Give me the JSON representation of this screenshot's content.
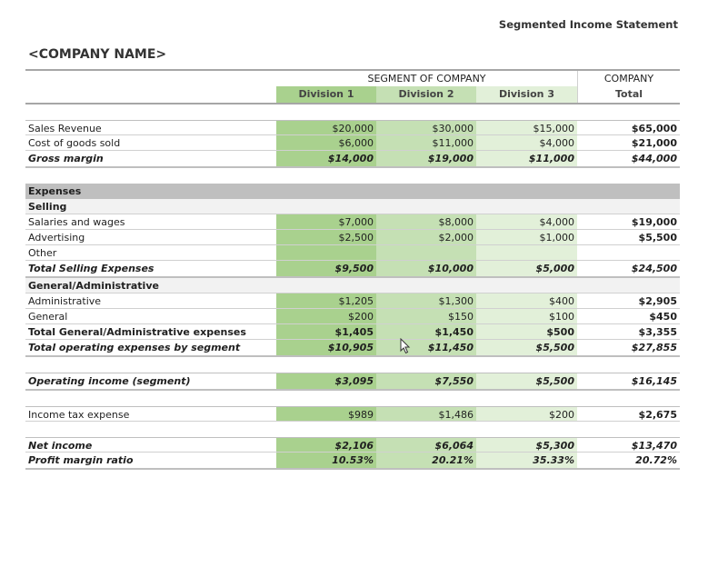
{
  "doc_title": "Segmented Income Statement",
  "company_name": "<COMPANY NAME>",
  "header": {
    "segment_label": "SEGMENT OF COMPANY",
    "company_label": "COMPANY",
    "divisions": [
      "Division 1",
      "Division 2",
      "Division 3"
    ],
    "total_label": "Total"
  },
  "revenue": [
    {
      "label": "Sales Revenue",
      "d1": "$20,000",
      "d2": "$30,000",
      "d3": "$15,000",
      "total": "$65,000"
    },
    {
      "label": "Cost of goods sold",
      "d1": "$6,000",
      "d2": "$11,000",
      "d3": "$4,000",
      "total": "$21,000"
    },
    {
      "label": "Gross margin",
      "d1": "$14,000",
      "d2": "$19,000",
      "d3": "$11,000",
      "total": "$44,000"
    }
  ],
  "expenses_label": "Expenses",
  "selling_label": "Selling",
  "selling": [
    {
      "label": "Salaries and wages",
      "d1": "$7,000",
      "d2": "$8,000",
      "d3": "$4,000",
      "total": "$19,000"
    },
    {
      "label": "Advertising",
      "d1": "$2,500",
      "d2": "$2,000",
      "d3": "$1,000",
      "total": "$5,500"
    },
    {
      "label": "Other",
      "d1": "",
      "d2": "",
      "d3": "",
      "total": ""
    },
    {
      "label": "Total Selling Expenses",
      "d1": "$9,500",
      "d2": "$10,000",
      "d3": "$5,000",
      "total": "$24,500"
    }
  ],
  "ga_label": "General/Administrative",
  "ga": [
    {
      "label": "Administrative",
      "d1": "$1,205",
      "d2": "$1,300",
      "d3": "$400",
      "total": "$2,905"
    },
    {
      "label": "General",
      "d1": "$200",
      "d2": "$150",
      "d3": "$100",
      "total": "$450"
    },
    {
      "label": "Total General/Administrative expenses",
      "d1": "$1,405",
      "d2": "$1,450",
      "d3": "$500",
      "total": "$3,355"
    },
    {
      "label": "Total operating expenses by segment",
      "d1": "$10,905",
      "d2": "$11,450",
      "d3": "$5,500",
      "total": "$27,855"
    }
  ],
  "operating_income": {
    "label": "Operating income (segment)",
    "d1": "$3,095",
    "d2": "$7,550",
    "d3": "$5,500",
    "total": "$16,145"
  },
  "income_tax": {
    "label": "Income tax expense",
    "d1": "$989",
    "d2": "$1,486",
    "d3": "$200",
    "total": "$2,675"
  },
  "net_income": {
    "label": "Net income",
    "d1": "$2,106",
    "d2": "$6,064",
    "d3": "$5,300",
    "total": "$13,470"
  },
  "profit_margin": {
    "label": "Profit margin ratio",
    "d1": "10.53%",
    "d2": "20.21%",
    "d3": "35.33%",
    "total": "20.72%"
  },
  "colors": {
    "division1": "#a9d18e",
    "division2": "#c5e0b4",
    "division3": "#e2f0d9",
    "section": "#bfbfbf"
  }
}
